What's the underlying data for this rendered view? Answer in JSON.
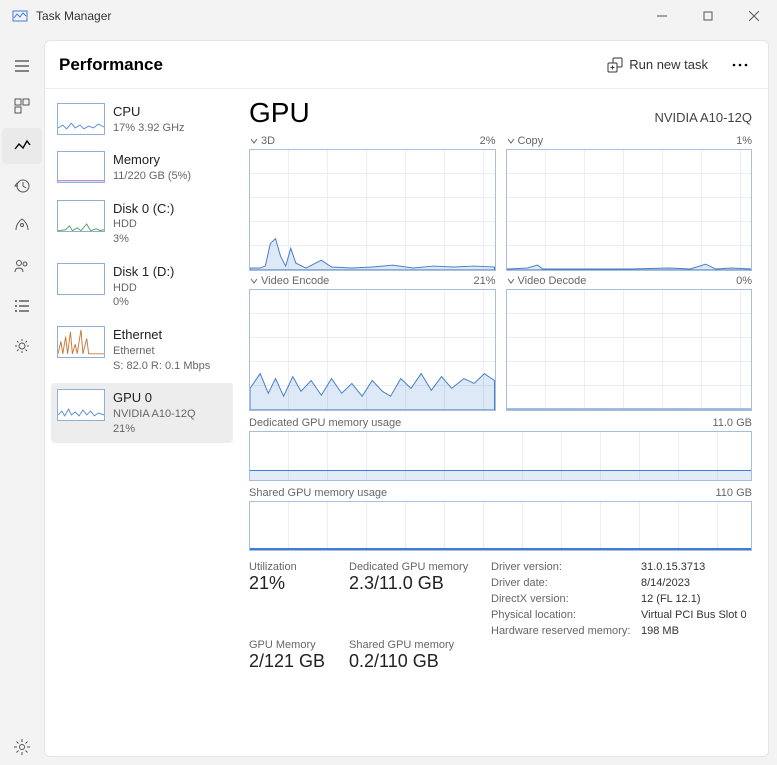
{
  "window": {
    "title": "Task Manager"
  },
  "header": {
    "section": "Performance",
    "run_task": "Run new task"
  },
  "sidebar": {
    "items": [
      {
        "name": "CPU",
        "sub1": "17% 3.92 GHz",
        "sub2": ""
      },
      {
        "name": "Memory",
        "sub1": "11/220 GB (5%)",
        "sub2": ""
      },
      {
        "name": "Disk 0 (C:)",
        "sub1": "HDD",
        "sub2": "3%"
      },
      {
        "name": "Disk 1 (D:)",
        "sub1": "HDD",
        "sub2": "0%"
      },
      {
        "name": "Ethernet",
        "sub1": "Ethernet",
        "sub2": "S: 82.0 R: 0.1 Mbps"
      },
      {
        "name": "GPU 0",
        "sub1": "NVIDIA A10-12Q",
        "sub2": "21%"
      }
    ]
  },
  "detail": {
    "title": "GPU",
    "device": "NVIDIA A10-12Q",
    "engines": [
      {
        "label": "3D",
        "pct": "2%"
      },
      {
        "label": "Copy",
        "pct": "1%"
      },
      {
        "label": "Video Encode",
        "pct": "21%"
      },
      {
        "label": "Video Decode",
        "pct": "0%"
      }
    ],
    "dedicated": {
      "label": "Dedicated GPU memory usage",
      "max": "11.0 GB"
    },
    "shared": {
      "label": "Shared GPU memory usage",
      "max": "110 GB"
    },
    "stats": {
      "util_label": "Utilization",
      "util_value": "21%",
      "ded_label": "Dedicated GPU memory",
      "ded_value": "2.3/11.0 GB",
      "gpumem_label": "GPU Memory",
      "gpumem_value": "2/121 GB",
      "shmem_label": "Shared GPU memory",
      "shmem_value": "0.2/110 GB"
    },
    "info": {
      "driver_version_k": "Driver version:",
      "driver_version_v": "31.0.15.3713",
      "driver_date_k": "Driver date:",
      "driver_date_v": "8/14/2023",
      "dx_k": "DirectX version:",
      "dx_v": "12 (FL 12.1)",
      "loc_k": "Physical location:",
      "loc_v": "Virtual PCI Bus Slot 0",
      "hwres_k": "Hardware reserved memory:",
      "hwres_v": "198 MB"
    }
  }
}
